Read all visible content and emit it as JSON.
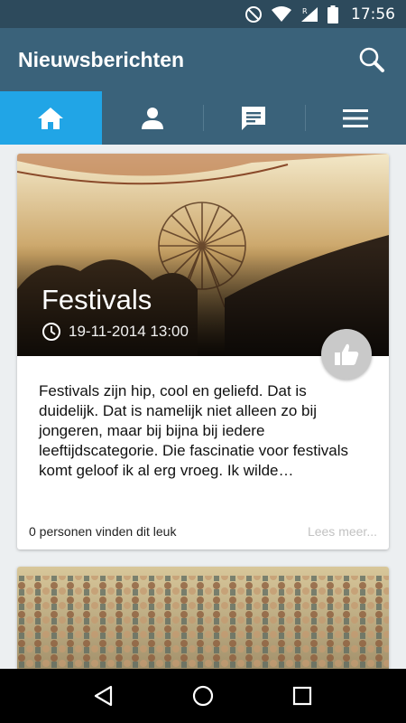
{
  "status_bar": {
    "time": "17:56",
    "icons": [
      "do-not-disturb-icon",
      "wifi-icon",
      "signal-icon",
      "battery-icon"
    ]
  },
  "app_bar": {
    "title": "Nieuwsberichten",
    "search_icon": "search-icon"
  },
  "tabs": [
    {
      "name": "home",
      "icon": "home-icon",
      "active": true
    },
    {
      "name": "profile",
      "icon": "person-icon",
      "active": false
    },
    {
      "name": "messages",
      "icon": "chat-icon",
      "active": false
    },
    {
      "name": "menu",
      "icon": "menu-icon",
      "active": false
    }
  ],
  "articles": [
    {
      "title": "Festivals",
      "date": "19-11-2014 13:00",
      "excerpt": "Festivals zijn hip, cool en geliefd. Dat is duidelijk. Dat is namelijk niet alleen zo bij jongeren, maar bij bijna bij iedere leeftijdscategorie. Die fascinatie voor festivals komt geloof ik al erg vroeg. Ik wilde…",
      "likes_text": "0 personen vinden dit leuk",
      "read_more": "Lees meer..."
    }
  ],
  "colors": {
    "status_bar": "#2d4a5c",
    "app_bar": "#3a627a",
    "active_tab": "#21a5e6",
    "like_button": "#c9c9c9"
  },
  "nav_bar": {
    "icons": [
      "back-icon",
      "home-circle-icon",
      "recents-icon"
    ]
  }
}
